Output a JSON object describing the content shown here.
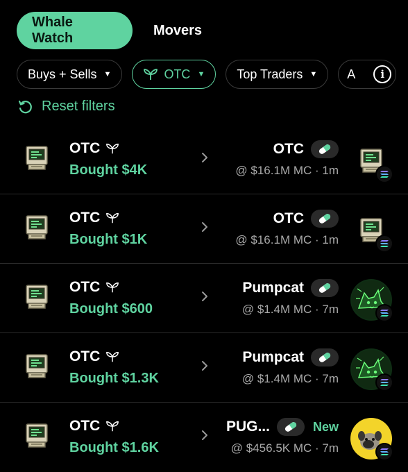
{
  "tabs": [
    {
      "label": "Whale Watch",
      "active": true
    },
    {
      "label": "Movers",
      "active": false
    }
  ],
  "filters": {
    "side": "Buys + Sells",
    "category": "OTC",
    "traders": "Top Traders",
    "partial": "A",
    "info": "i"
  },
  "reset_label": "Reset filters",
  "accent_color": "#5fd3a0",
  "rows": [
    {
      "trader": "OTC",
      "action": "Bought $4K",
      "token": "OTC",
      "mc": "@ $16.1M MC · 1m",
      "new": "",
      "avatar": "computer-icon"
    },
    {
      "trader": "OTC",
      "action": "Bought $1K",
      "token": "OTC",
      "mc": "@ $16.1M MC · 1m",
      "new": "",
      "avatar": "computer-icon"
    },
    {
      "trader": "OTC",
      "action": "Bought $600",
      "token": "Pumpcat",
      "mc": "@ $1.4M MC · 7m",
      "new": "",
      "avatar": "cat-icon"
    },
    {
      "trader": "OTC",
      "action": "Bought $1.3K",
      "token": "Pumpcat",
      "mc": "@ $1.4M MC · 7m",
      "new": "",
      "avatar": "cat-icon"
    },
    {
      "trader": "OTC",
      "action": "Bought $1.6K",
      "token": "PUG...",
      "mc": "@ $456.5K MC · 7m",
      "new": "New",
      "avatar": "pug-icon"
    }
  ]
}
